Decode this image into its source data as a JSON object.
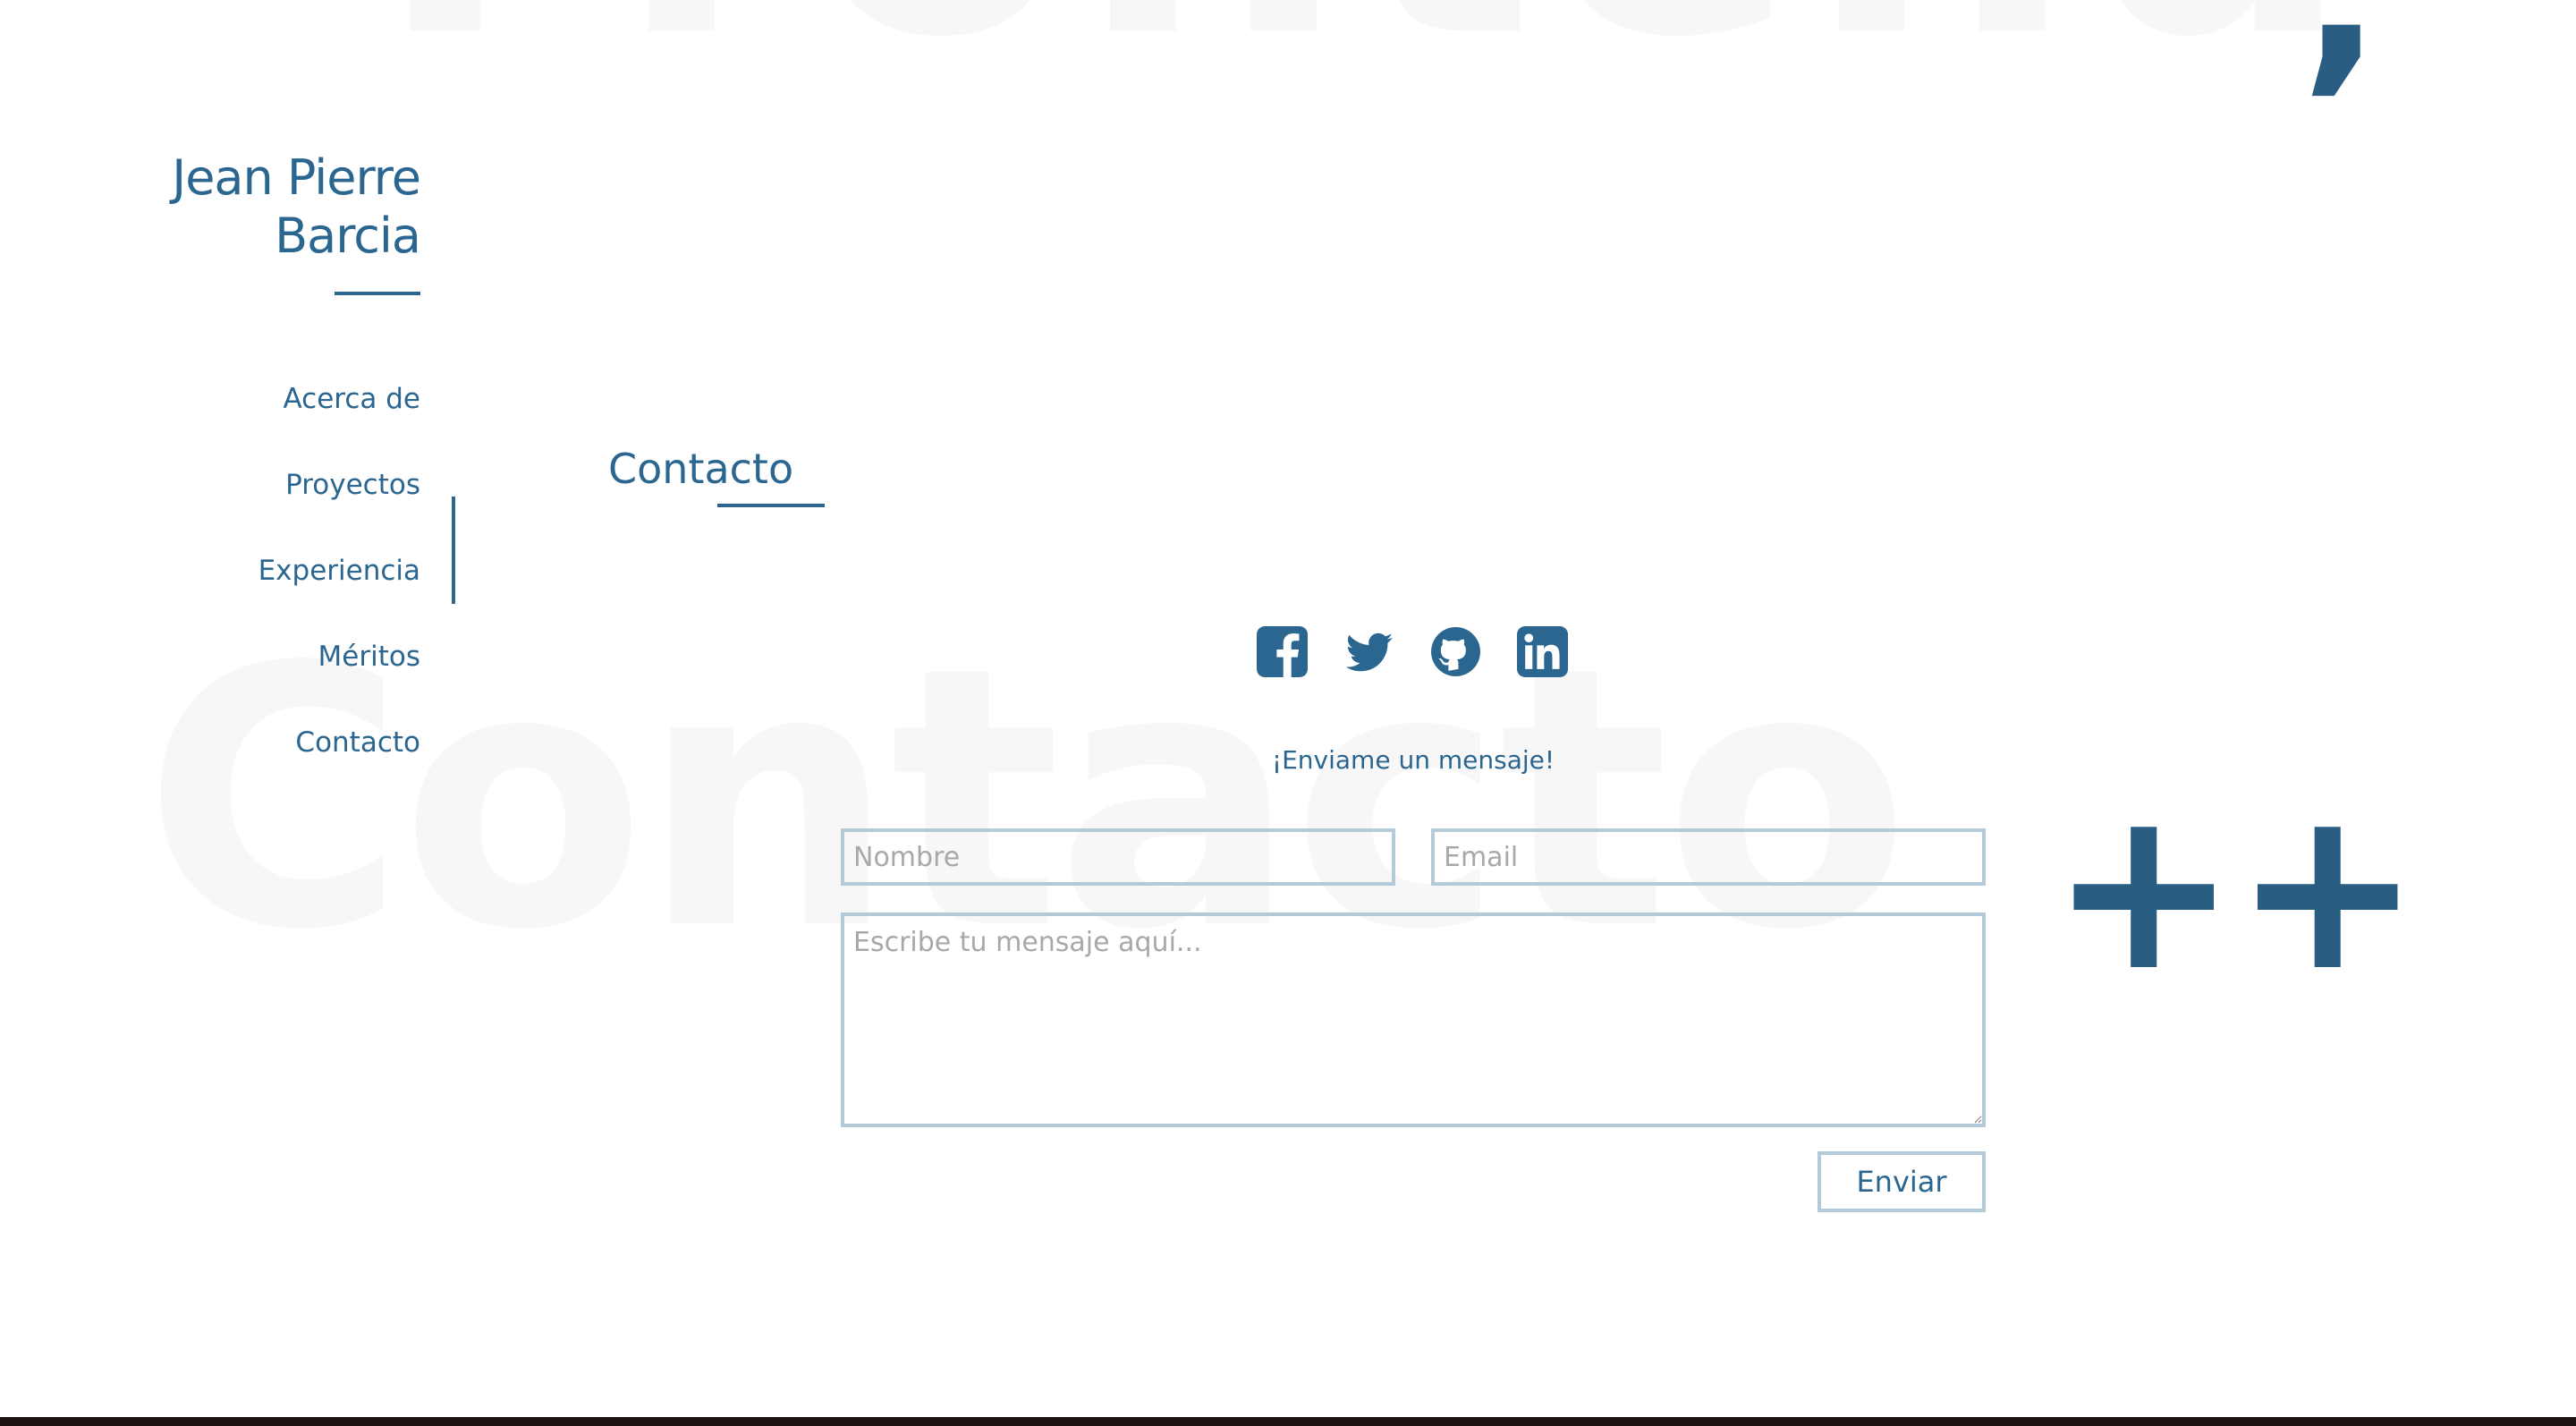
{
  "decor": {
    "watermark_top": "Frontend",
    "watermark_main": "Contacto",
    "comma_glyph": ",",
    "plusplus_glyph": "++"
  },
  "colors": {
    "accent": "#2a6690",
    "field_border": "#b5cad8",
    "watermark": "#f7f7f7"
  },
  "brand": {
    "line1": "Jean Pierre",
    "line2": "Barcia"
  },
  "nav": {
    "items": [
      {
        "label": "Acerca de"
      },
      {
        "label": "Proyectos"
      },
      {
        "label": "Experiencia",
        "active": true
      },
      {
        "label": "Méritos"
      },
      {
        "label": "Contacto"
      }
    ]
  },
  "section": {
    "title": "Contacto"
  },
  "social": {
    "icons": [
      "facebook-icon",
      "twitter-icon",
      "github-icon",
      "linkedin-icon"
    ]
  },
  "form": {
    "intro": "¡Enviame un mensaje!",
    "name_placeholder": "Nombre",
    "email_placeholder": "Email",
    "message_placeholder": "Escribe tu mensaje aquí...",
    "submit_label": "Enviar"
  }
}
